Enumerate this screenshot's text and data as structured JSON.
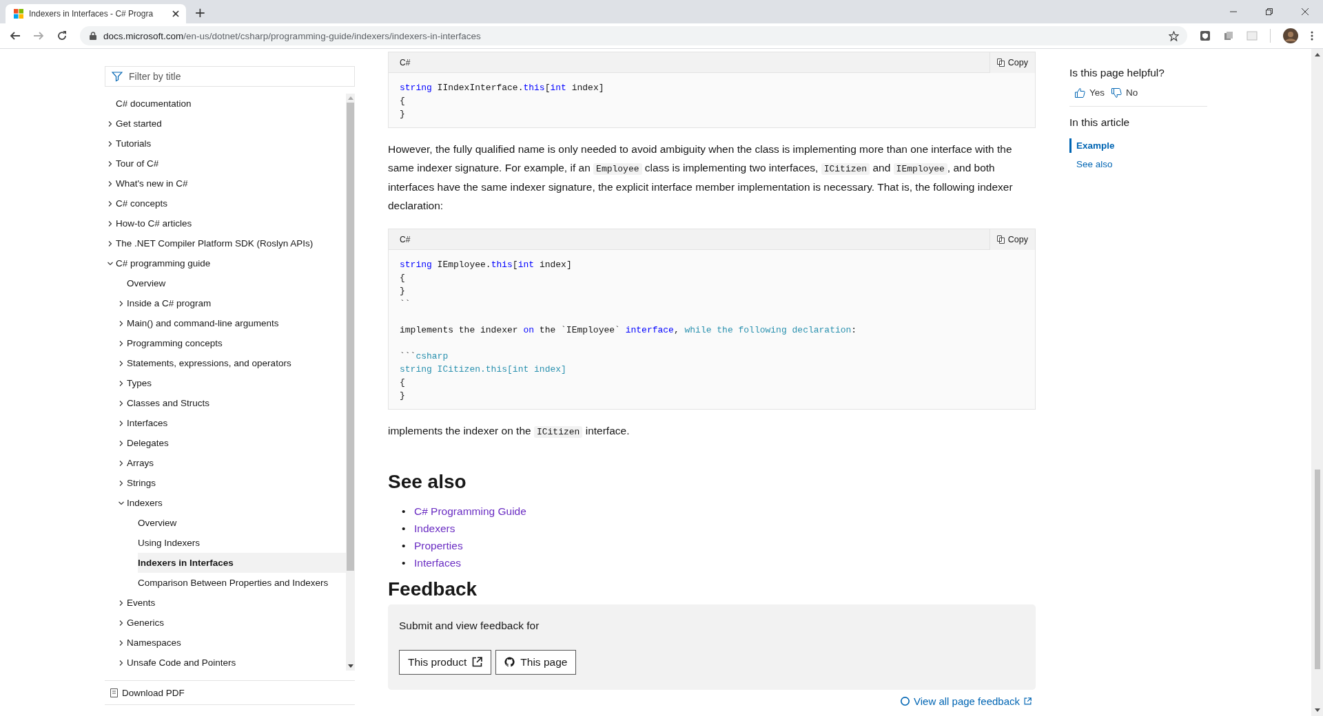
{
  "browser": {
    "tab_title": "Indexers in Interfaces - C# Progra",
    "new_tab": "+",
    "url_host": "docs.microsoft.com",
    "url_path": "/en-us/dotnet/csharp/programming-guide/indexers/indexers-in-interfaces"
  },
  "sidebar": {
    "filter_placeholder": "Filter by title",
    "toc": [
      {
        "label": "C# documentation",
        "selected": false
      },
      {
        "label": "Get started",
        "expanded": false,
        "selected": false
      },
      {
        "label": "Tutorials",
        "expanded": false,
        "selected": false
      },
      {
        "label": "Tour of C#",
        "expanded": false,
        "selected": false
      },
      {
        "label": "What's new in C#",
        "expanded": false,
        "selected": false
      },
      {
        "label": "C# concepts",
        "expanded": false,
        "selected": false
      },
      {
        "label": "How-to C# articles",
        "expanded": false,
        "selected": false
      },
      {
        "label": "The .NET Compiler Platform SDK (Roslyn APIs)",
        "expanded": false,
        "selected": false
      },
      {
        "label": "C# programming guide",
        "expanded": true,
        "selected": false,
        "children": [
          {
            "label": "Overview",
            "selected": false
          },
          {
            "label": "Inside a C# program",
            "expanded": false,
            "selected": false
          },
          {
            "label": "Main() and command-line arguments",
            "expanded": false,
            "selected": false
          },
          {
            "label": "Programming concepts",
            "expanded": false,
            "selected": false
          },
          {
            "label": "Statements, expressions, and operators",
            "expanded": false,
            "selected": false
          },
          {
            "label": "Types",
            "expanded": false,
            "selected": false
          },
          {
            "label": "Classes and Structs",
            "expanded": false,
            "selected": false
          },
          {
            "label": "Interfaces",
            "expanded": false,
            "selected": false
          },
          {
            "label": "Delegates",
            "expanded": false,
            "selected": false
          },
          {
            "label": "Arrays",
            "expanded": false,
            "selected": false
          },
          {
            "label": "Strings",
            "expanded": false,
            "selected": false
          },
          {
            "label": "Indexers",
            "expanded": true,
            "selected": false,
            "children": [
              {
                "label": "Overview",
                "selected": false
              },
              {
                "label": "Using Indexers",
                "selected": false
              },
              {
                "label": "Indexers in Interfaces",
                "selected": true
              },
              {
                "label": "Comparison Between Properties and Indexers",
                "selected": false
              }
            ]
          },
          {
            "label": "Events",
            "expanded": false,
            "selected": false
          },
          {
            "label": "Generics",
            "expanded": false,
            "selected": false
          },
          {
            "label": "Namespaces",
            "expanded": false,
            "selected": false
          },
          {
            "label": "Unsafe Code and Pointers",
            "expanded": false,
            "selected": false
          }
        ]
      }
    ],
    "download": "Download PDF"
  },
  "content": [
    {
      "kind": "code",
      "language": "C#",
      "copy": "Copy",
      "tokens": [
        {
          "text": "string",
          "kind": "keyword"
        },
        {
          "text": " IIndexInterface.",
          "kind": "plain"
        },
        {
          "text": "this",
          "kind": "keyword"
        },
        {
          "text": "[",
          "kind": "plain"
        },
        {
          "text": "int",
          "kind": "keyword"
        },
        {
          "text": " index]\n{\n}",
          "kind": "plain"
        }
      ]
    },
    {
      "kind": "paragraph",
      "segments": [
        {
          "text": "However, the fully qualified name is only needed to avoid ambiguity when the class is implementing more than one interface with the same indexer signature. For example, if an ",
          "kind": "text"
        },
        {
          "text": "Employee",
          "kind": "code"
        },
        {
          "text": " class is implementing two interfaces, ",
          "kind": "text"
        },
        {
          "text": "ICitizen",
          "kind": "code"
        },
        {
          "text": " and ",
          "kind": "text"
        },
        {
          "text": "IEmployee",
          "kind": "code"
        },
        {
          "text": ", and both interfaces have the same indexer signature, the explicit interface member implementation is necessary. That is, the following indexer declaration:",
          "kind": "text"
        }
      ]
    },
    {
      "kind": "code",
      "language": "C#",
      "copy": "Copy",
      "tokens": [
        {
          "text": "string",
          "kind": "keyword"
        },
        {
          "text": " IEmployee.",
          "kind": "plain"
        },
        {
          "text": "this",
          "kind": "keyword"
        },
        {
          "text": "[",
          "kind": "plain"
        },
        {
          "text": "int",
          "kind": "keyword"
        },
        {
          "text": " index]\n{\n}\n``\n\nimplements the indexer ",
          "kind": "plain"
        },
        {
          "text": "on",
          "kind": "keyword"
        },
        {
          "text": " the `IEmployee` ",
          "kind": "plain"
        },
        {
          "text": "interface",
          "kind": "keyword"
        },
        {
          "text": ", ",
          "kind": "plain"
        },
        {
          "text": "while the following declaration",
          "kind": "type"
        },
        {
          "text": ":\n\n```",
          "kind": "plain"
        },
        {
          "text": "csharp\nstring ICitizen.this[int index]",
          "kind": "type"
        },
        {
          "text": "\n{\n}",
          "kind": "plain"
        }
      ]
    },
    {
      "kind": "paragraph",
      "segments": [
        {
          "text": "implements the indexer on the ",
          "kind": "text"
        },
        {
          "text": "ICitizen",
          "kind": "code"
        },
        {
          "text": " interface.",
          "kind": "text"
        }
      ]
    }
  ],
  "see_also": {
    "heading": "See also",
    "bullet": "•",
    "links": [
      "C# Programming Guide",
      "Indexers",
      "Properties",
      "Interfaces"
    ]
  },
  "feedback": {
    "heading": "Feedback",
    "prompt": "Submit and view feedback for",
    "product_button": "This product",
    "page_button": "This page",
    "view_all": "View all page feedback"
  },
  "rail": {
    "helpful_question": "Is this page helpful?",
    "yes": "Yes",
    "no": "No",
    "in_this_article": "In this article",
    "links": [
      {
        "label": "Example",
        "selected": true
      },
      {
        "label": "See also",
        "selected": false
      }
    ]
  }
}
